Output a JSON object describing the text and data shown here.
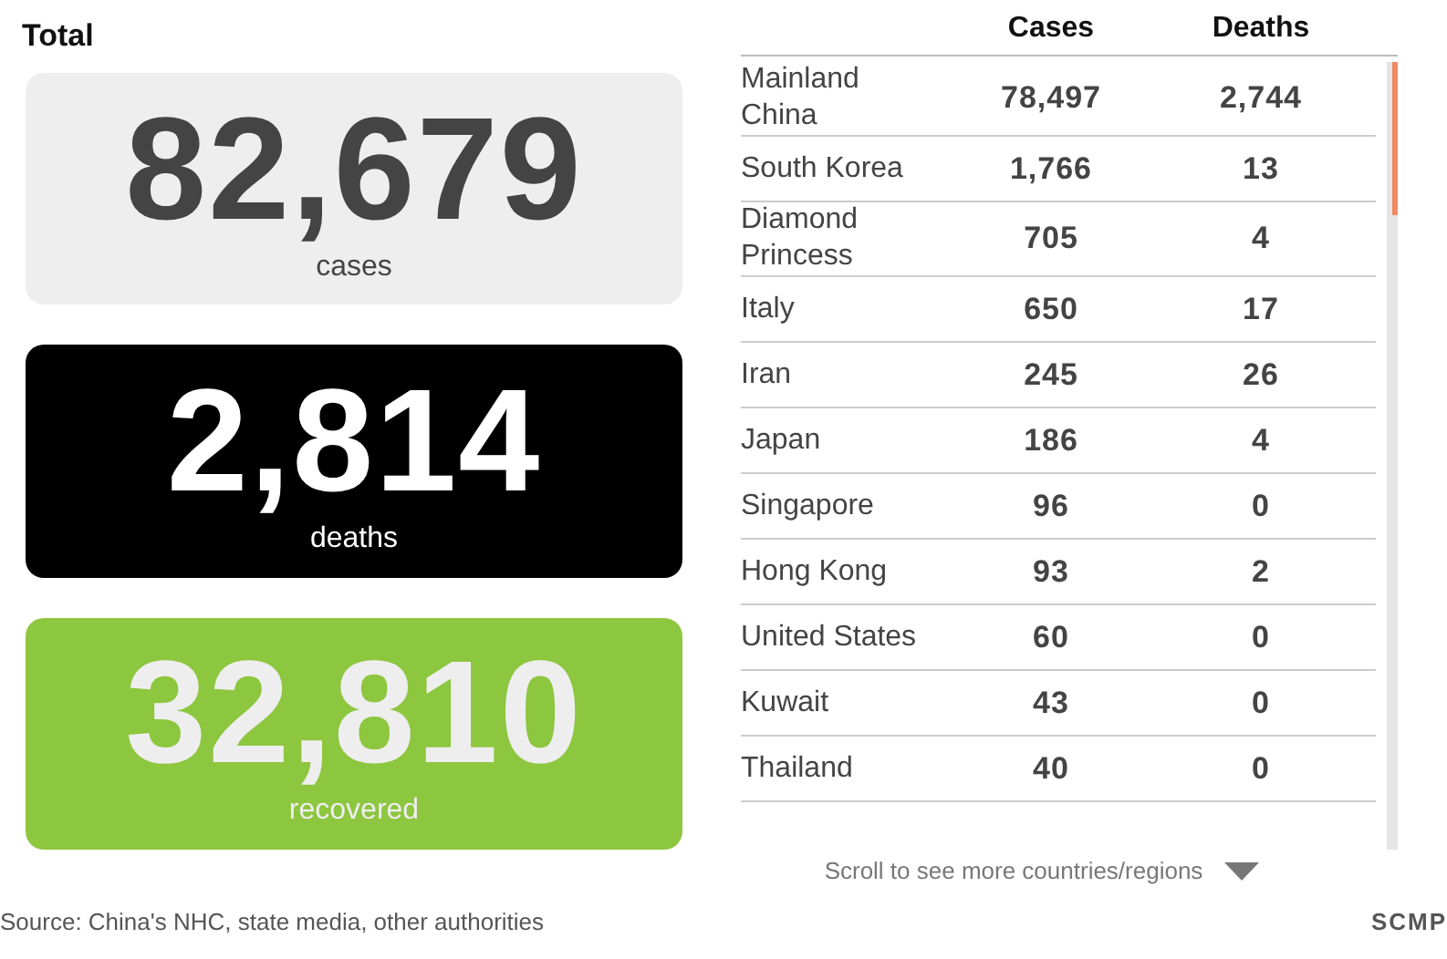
{
  "total": {
    "title": "Total",
    "cards": [
      {
        "kind": "cases",
        "value": "82,679",
        "label": "cases"
      },
      {
        "kind": "deaths",
        "value": "2,814",
        "label": "deaths"
      },
      {
        "kind": "recovered",
        "value": "32,810",
        "label": "recovered"
      }
    ]
  },
  "table": {
    "columns": [
      "Cases",
      "Deaths"
    ],
    "rows": [
      {
        "name": "Mainland China",
        "cases": "78,497",
        "deaths": "2,744"
      },
      {
        "name": "South Korea",
        "cases": "1,766",
        "deaths": "13"
      },
      {
        "name": "Diamond Princess",
        "cases": "705",
        "deaths": "4"
      },
      {
        "name": "Italy",
        "cases": "650",
        "deaths": "17"
      },
      {
        "name": "Iran",
        "cases": "245",
        "deaths": "26"
      },
      {
        "name": "Japan",
        "cases": "186",
        "deaths": "4"
      },
      {
        "name": "Singapore",
        "cases": "96",
        "deaths": "0"
      },
      {
        "name": "Hong Kong",
        "cases": "93",
        "deaths": "2"
      },
      {
        "name": "United States",
        "cases": "60",
        "deaths": "0"
      },
      {
        "name": "Kuwait",
        "cases": "43",
        "deaths": "0"
      },
      {
        "name": "Thailand",
        "cases": "40",
        "deaths": "0"
      }
    ],
    "scroll_hint": "Scroll to see more countries/regions"
  },
  "footer": {
    "source": "Source: China's NHC, state media, other authorities",
    "brand": "SCMP"
  }
}
